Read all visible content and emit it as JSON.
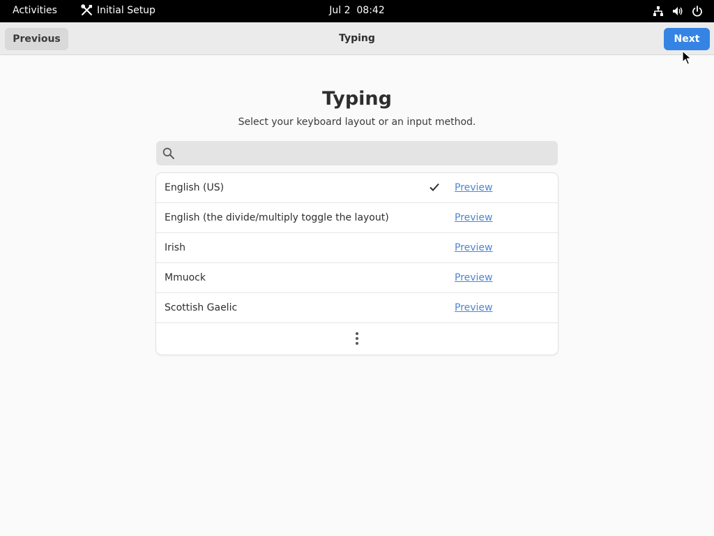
{
  "topbar": {
    "activities": "Activities",
    "app_name": "Initial Setup",
    "app_icon": "tools-icon",
    "date": "Jul 2",
    "time": "08:42",
    "tray_icons": [
      "network-icon",
      "volume-icon",
      "power-icon"
    ]
  },
  "header": {
    "previous_label": "Previous",
    "title": "Typing",
    "next_label": "Next"
  },
  "main": {
    "title": "Typing",
    "subtitle": "Select your keyboard layout or an input method.",
    "search": {
      "icon": "search-icon",
      "value": "",
      "placeholder": ""
    },
    "layouts": [
      {
        "name": "English (US)",
        "selected": true,
        "preview_label": "Preview"
      },
      {
        "name": "English (the divide/multiply toggle the layout)",
        "selected": false,
        "preview_label": "Preview"
      },
      {
        "name": "Irish",
        "selected": false,
        "preview_label": "Preview"
      },
      {
        "name": "Mmuock",
        "selected": false,
        "preview_label": "Preview"
      },
      {
        "name": "Scottish Gaelic",
        "selected": false,
        "preview_label": "Preview"
      }
    ],
    "more_icon": "view-more-icon"
  },
  "colors": {
    "accent": "#3584e4",
    "link": "#4a86d4",
    "topbar_bg": "#000000",
    "page_bg": "#fafafa"
  }
}
